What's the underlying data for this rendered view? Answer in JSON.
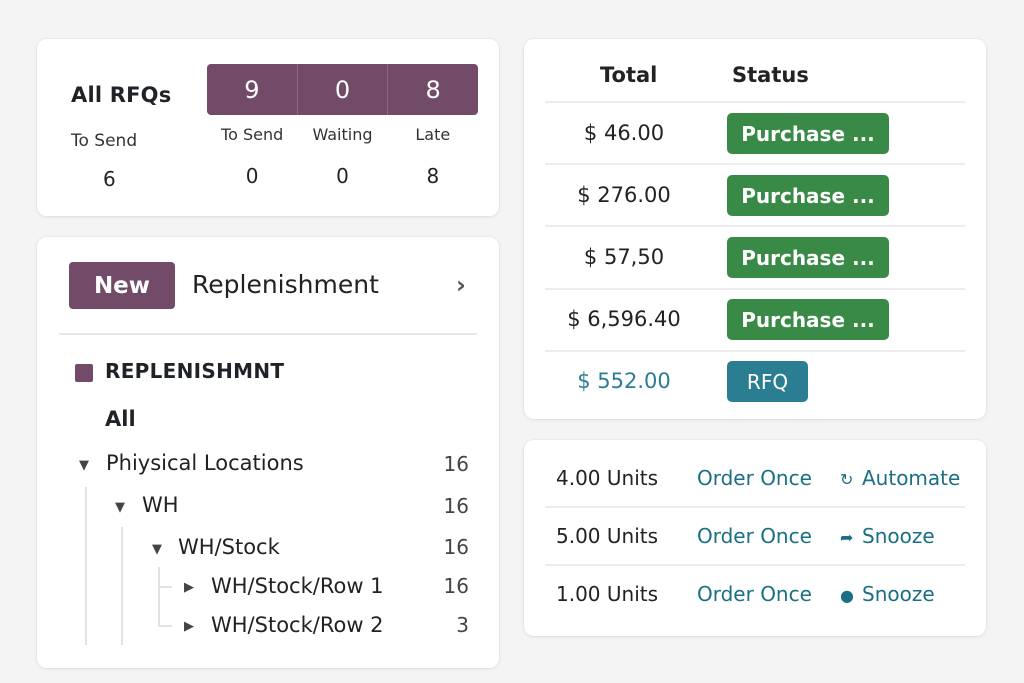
{
  "rfq_summary": {
    "title": "All RFQs",
    "left_label": "To Send",
    "left_value": "6",
    "tiles": [
      "9",
      "0",
      "8"
    ],
    "columns": [
      {
        "label": "To Send",
        "value": "0"
      },
      {
        "label": "Waiting",
        "value": "0"
      },
      {
        "label": "Late",
        "value": "8"
      }
    ]
  },
  "replenishment": {
    "new_button": "New",
    "title": "Replenishment",
    "chevron": "›",
    "section_title": "REPLENISHMNT",
    "all_label": "All",
    "tree": [
      {
        "label": "Phiysical Locations",
        "count": "16"
      },
      {
        "label": "WH",
        "count": "16"
      },
      {
        "label": "WH/Stock",
        "count": "16"
      },
      {
        "label": "WH/Stock/Row 1",
        "count": "16"
      },
      {
        "label": "WH/Stock/Row 2",
        "count": "3"
      }
    ]
  },
  "orders": {
    "headers": {
      "total": "Total",
      "status": "Status"
    },
    "rows": [
      {
        "amount": "$ 46.00",
        "status": "Purchase ..."
      },
      {
        "amount": "$ 276.00",
        "status": "Purchase ..."
      },
      {
        "amount": "$ 57,50",
        "status": "Purchase ..."
      },
      {
        "amount": "$ 6,596.40",
        "status": "Purchase ..."
      },
      {
        "amount": "$ 552.00",
        "status": "RFQ"
      }
    ]
  },
  "actions": {
    "rows": [
      {
        "units": "4.00 Units",
        "order": "Order Once",
        "action": "Automate",
        "icon": "refresh-icon"
      },
      {
        "units": "5.00 Units",
        "order": "Order Once",
        "action": "Snooze",
        "icon": "forward-arrow-icon"
      },
      {
        "units": "1.00 Units",
        "order": "Order Once",
        "action": "Snooze",
        "icon": "info-circle-icon"
      }
    ]
  },
  "colors": {
    "brand": "#714b67",
    "purchase_badge": "#3a8a47",
    "rfq_badge": "#2b7d92",
    "link": "#1b6f85"
  }
}
